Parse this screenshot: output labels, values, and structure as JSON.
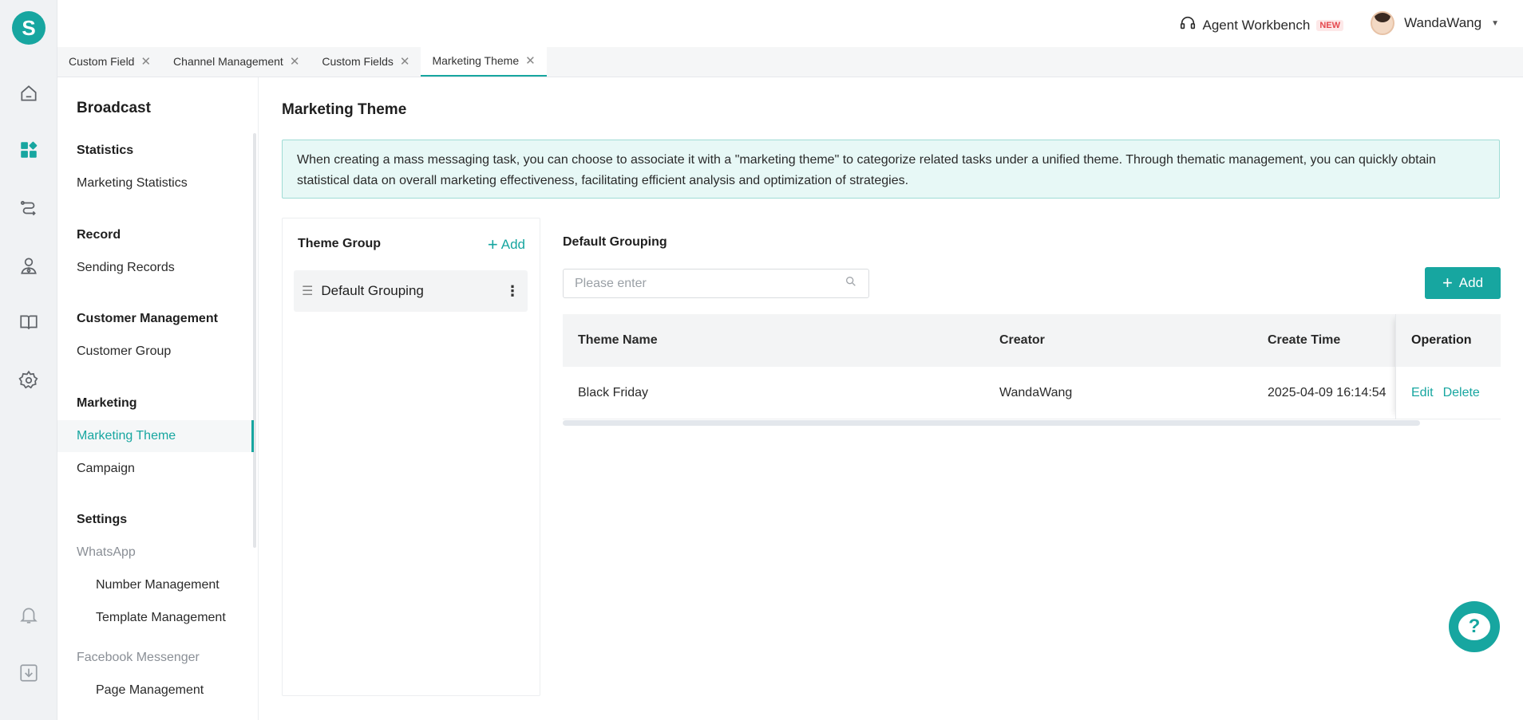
{
  "app": {
    "logo_letter": "S"
  },
  "rail": {
    "items": [
      {
        "icon": "home-icon"
      },
      {
        "icon": "apps-icon",
        "active": true
      },
      {
        "icon": "route-icon"
      },
      {
        "icon": "contact-icon"
      },
      {
        "icon": "book-icon"
      },
      {
        "icon": "gear-icon"
      },
      {
        "icon": "bell-icon"
      },
      {
        "icon": "download-icon"
      }
    ]
  },
  "topbar": {
    "workbench_label": "Agent Workbench",
    "new_badge": "NEW",
    "user_name": "WandaWang"
  },
  "tabs": [
    {
      "label": "Custom Field"
    },
    {
      "label": "Channel Management"
    },
    {
      "label": "Custom Fields"
    },
    {
      "label": "Marketing Theme",
      "active": true
    }
  ],
  "sidebar": {
    "title": "Broadcast",
    "groups": {
      "statistics": "Statistics",
      "record": "Record",
      "customer_management": "Customer Management",
      "marketing": "Marketing",
      "settings": "Settings"
    },
    "items": {
      "marketing_statistics": "Marketing Statistics",
      "sending_records": "Sending Records",
      "customer_group": "Customer Group",
      "marketing_theme": "Marketing Theme",
      "campaign": "Campaign",
      "whatsapp": "WhatsApp",
      "number_management": "Number Management",
      "template_management": "Template Management",
      "facebook_messenger": "Facebook Messenger",
      "page_management": "Page Management"
    }
  },
  "main": {
    "title": "Marketing Theme",
    "notice": "When creating a mass messaging task, you can choose to associate it with a \"marketing theme\" to categorize related tasks under a unified theme. Through thematic management, you can quickly obtain statistical data on overall marketing effectiveness, facilitating efficient analysis and optimization of strategies.",
    "theme_group": {
      "title": "Theme Group",
      "add_label": "Add",
      "items": [
        {
          "label": "Default Grouping"
        }
      ]
    },
    "grouping": {
      "title": "Default Grouping",
      "search_placeholder": "Please enter",
      "add_label": "Add",
      "columns": {
        "name": "Theme Name",
        "creator": "Creator",
        "create_time": "Create Time",
        "operation": "Operation"
      },
      "rows": [
        {
          "name": "Black Friday",
          "creator": "WandaWang",
          "create_time": "2025-04-09 16:14:54",
          "edit": "Edit",
          "delete": "Delete"
        }
      ]
    }
  },
  "colors": {
    "accent": "#17a6a0",
    "notice_bg": "#e7f8f6"
  }
}
